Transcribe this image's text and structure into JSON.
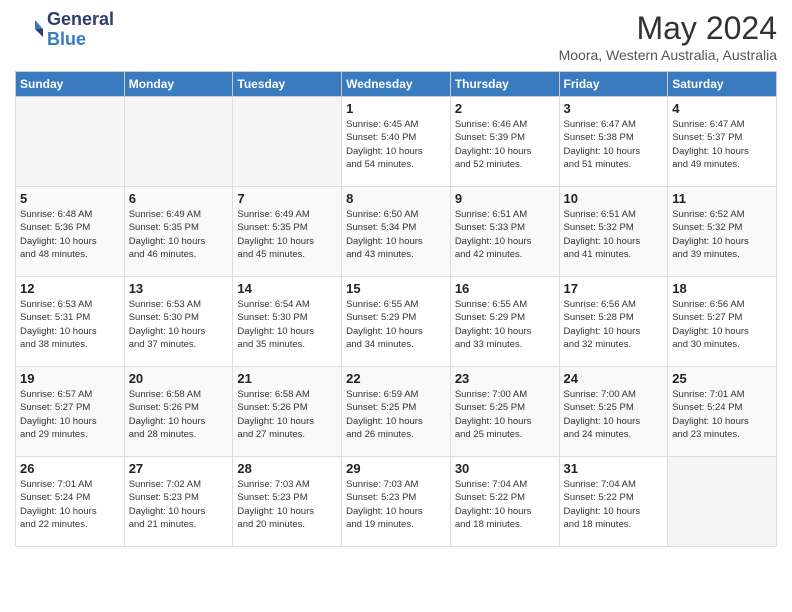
{
  "header": {
    "logo_general": "General",
    "logo_blue": "Blue",
    "month_year": "May 2024",
    "location": "Moora, Western Australia, Australia"
  },
  "weekdays": [
    "Sunday",
    "Monday",
    "Tuesday",
    "Wednesday",
    "Thursday",
    "Friday",
    "Saturday"
  ],
  "weeks": [
    [
      {
        "day": "",
        "info": ""
      },
      {
        "day": "",
        "info": ""
      },
      {
        "day": "",
        "info": ""
      },
      {
        "day": "1",
        "info": "Sunrise: 6:45 AM\nSunset: 5:40 PM\nDaylight: 10 hours\nand 54 minutes."
      },
      {
        "day": "2",
        "info": "Sunrise: 6:46 AM\nSunset: 5:39 PM\nDaylight: 10 hours\nand 52 minutes."
      },
      {
        "day": "3",
        "info": "Sunrise: 6:47 AM\nSunset: 5:38 PM\nDaylight: 10 hours\nand 51 minutes."
      },
      {
        "day": "4",
        "info": "Sunrise: 6:47 AM\nSunset: 5:37 PM\nDaylight: 10 hours\nand 49 minutes."
      }
    ],
    [
      {
        "day": "5",
        "info": "Sunrise: 6:48 AM\nSunset: 5:36 PM\nDaylight: 10 hours\nand 48 minutes."
      },
      {
        "day": "6",
        "info": "Sunrise: 6:49 AM\nSunset: 5:35 PM\nDaylight: 10 hours\nand 46 minutes."
      },
      {
        "day": "7",
        "info": "Sunrise: 6:49 AM\nSunset: 5:35 PM\nDaylight: 10 hours\nand 45 minutes."
      },
      {
        "day": "8",
        "info": "Sunrise: 6:50 AM\nSunset: 5:34 PM\nDaylight: 10 hours\nand 43 minutes."
      },
      {
        "day": "9",
        "info": "Sunrise: 6:51 AM\nSunset: 5:33 PM\nDaylight: 10 hours\nand 42 minutes."
      },
      {
        "day": "10",
        "info": "Sunrise: 6:51 AM\nSunset: 5:32 PM\nDaylight: 10 hours\nand 41 minutes."
      },
      {
        "day": "11",
        "info": "Sunrise: 6:52 AM\nSunset: 5:32 PM\nDaylight: 10 hours\nand 39 minutes."
      }
    ],
    [
      {
        "day": "12",
        "info": "Sunrise: 6:53 AM\nSunset: 5:31 PM\nDaylight: 10 hours\nand 38 minutes."
      },
      {
        "day": "13",
        "info": "Sunrise: 6:53 AM\nSunset: 5:30 PM\nDaylight: 10 hours\nand 37 minutes."
      },
      {
        "day": "14",
        "info": "Sunrise: 6:54 AM\nSunset: 5:30 PM\nDaylight: 10 hours\nand 35 minutes."
      },
      {
        "day": "15",
        "info": "Sunrise: 6:55 AM\nSunset: 5:29 PM\nDaylight: 10 hours\nand 34 minutes."
      },
      {
        "day": "16",
        "info": "Sunrise: 6:55 AM\nSunset: 5:29 PM\nDaylight: 10 hours\nand 33 minutes."
      },
      {
        "day": "17",
        "info": "Sunrise: 6:56 AM\nSunset: 5:28 PM\nDaylight: 10 hours\nand 32 minutes."
      },
      {
        "day": "18",
        "info": "Sunrise: 6:56 AM\nSunset: 5:27 PM\nDaylight: 10 hours\nand 30 minutes."
      }
    ],
    [
      {
        "day": "19",
        "info": "Sunrise: 6:57 AM\nSunset: 5:27 PM\nDaylight: 10 hours\nand 29 minutes."
      },
      {
        "day": "20",
        "info": "Sunrise: 6:58 AM\nSunset: 5:26 PM\nDaylight: 10 hours\nand 28 minutes."
      },
      {
        "day": "21",
        "info": "Sunrise: 6:58 AM\nSunset: 5:26 PM\nDaylight: 10 hours\nand 27 minutes."
      },
      {
        "day": "22",
        "info": "Sunrise: 6:59 AM\nSunset: 5:25 PM\nDaylight: 10 hours\nand 26 minutes."
      },
      {
        "day": "23",
        "info": "Sunrise: 7:00 AM\nSunset: 5:25 PM\nDaylight: 10 hours\nand 25 minutes."
      },
      {
        "day": "24",
        "info": "Sunrise: 7:00 AM\nSunset: 5:25 PM\nDaylight: 10 hours\nand 24 minutes."
      },
      {
        "day": "25",
        "info": "Sunrise: 7:01 AM\nSunset: 5:24 PM\nDaylight: 10 hours\nand 23 minutes."
      }
    ],
    [
      {
        "day": "26",
        "info": "Sunrise: 7:01 AM\nSunset: 5:24 PM\nDaylight: 10 hours\nand 22 minutes."
      },
      {
        "day": "27",
        "info": "Sunrise: 7:02 AM\nSunset: 5:23 PM\nDaylight: 10 hours\nand 21 minutes."
      },
      {
        "day": "28",
        "info": "Sunrise: 7:03 AM\nSunset: 5:23 PM\nDaylight: 10 hours\nand 20 minutes."
      },
      {
        "day": "29",
        "info": "Sunrise: 7:03 AM\nSunset: 5:23 PM\nDaylight: 10 hours\nand 19 minutes."
      },
      {
        "day": "30",
        "info": "Sunrise: 7:04 AM\nSunset: 5:22 PM\nDaylight: 10 hours\nand 18 minutes."
      },
      {
        "day": "31",
        "info": "Sunrise: 7:04 AM\nSunset: 5:22 PM\nDaylight: 10 hours\nand 18 minutes."
      },
      {
        "day": "",
        "info": ""
      }
    ]
  ]
}
